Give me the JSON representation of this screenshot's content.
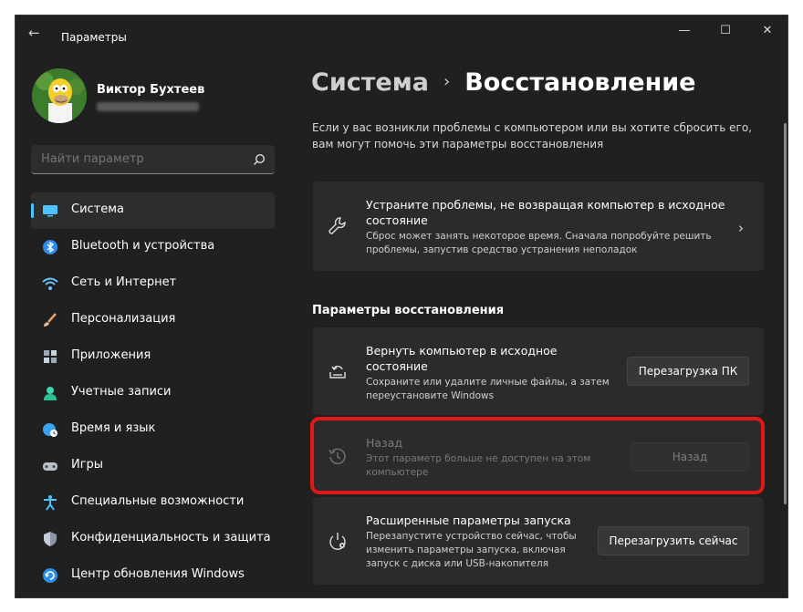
{
  "window": {
    "title": "Параметры"
  },
  "titlebar": {
    "back_icon": "back-arrow-icon",
    "controls": [
      "minimize-icon",
      "maximize-icon",
      "close-icon"
    ]
  },
  "profile": {
    "name": "Виктор Бухтеев"
  },
  "search": {
    "placeholder": "Найти параметр"
  },
  "sidebar": {
    "items": [
      {
        "label": "Система",
        "icon": "monitor-icon",
        "active": true
      },
      {
        "label": "Bluetooth и устройства",
        "icon": "bluetooth-icon"
      },
      {
        "label": "Сеть и Интернет",
        "icon": "wifi-icon"
      },
      {
        "label": "Персонализация",
        "icon": "brush-icon"
      },
      {
        "label": "Приложения",
        "icon": "apps-icon"
      },
      {
        "label": "Учетные записи",
        "icon": "person-icon"
      },
      {
        "label": "Время и язык",
        "icon": "globe-clock-icon"
      },
      {
        "label": "Игры",
        "icon": "gamepad-icon"
      },
      {
        "label": "Специальные возможности",
        "icon": "accessibility-icon"
      },
      {
        "label": "Конфиденциальность и защита",
        "icon": "shield-icon"
      },
      {
        "label": "Центр обновления Windows",
        "icon": "update-icon"
      }
    ]
  },
  "main": {
    "breadcrumb": {
      "parent": "Система",
      "separator": "›",
      "current": "Восстановление"
    },
    "intro": "Если у вас возникли проблемы с компьютером или вы хотите сбросить его, вам могут помочь эти параметры восстановления",
    "troubleshoot": {
      "title": "Устраните проблемы, не возвращая компьютер в исходное состояние",
      "desc": "Сброс может занять некоторое время. Сначала попробуйте решить проблемы, запустив средство устранения неполадок",
      "chevron": "›"
    },
    "section_title": "Параметры восстановления",
    "reset": {
      "title": "Вернуть компьютер в исходное состояние",
      "desc": "Сохраните или удалите личные файлы, а затем переустановите Windows",
      "button": "Перезагрузка ПК"
    },
    "goback": {
      "title": "Назад",
      "desc": "Этот параметр больше не доступен на этом компьютере",
      "button": "Назад"
    },
    "advanced": {
      "title": "Расширенные параметры запуска",
      "desc": "Перезапустите устройство сейчас, чтобы изменить параметры запуска, включая запуск с диска или USB-накопителя",
      "button": "Перезагрузить сейчас"
    }
  },
  "colors": {
    "accent": "#4cc2ff",
    "window_bg": "#202020",
    "card_bg": "#2b2b2b",
    "highlight": "#e01818"
  }
}
